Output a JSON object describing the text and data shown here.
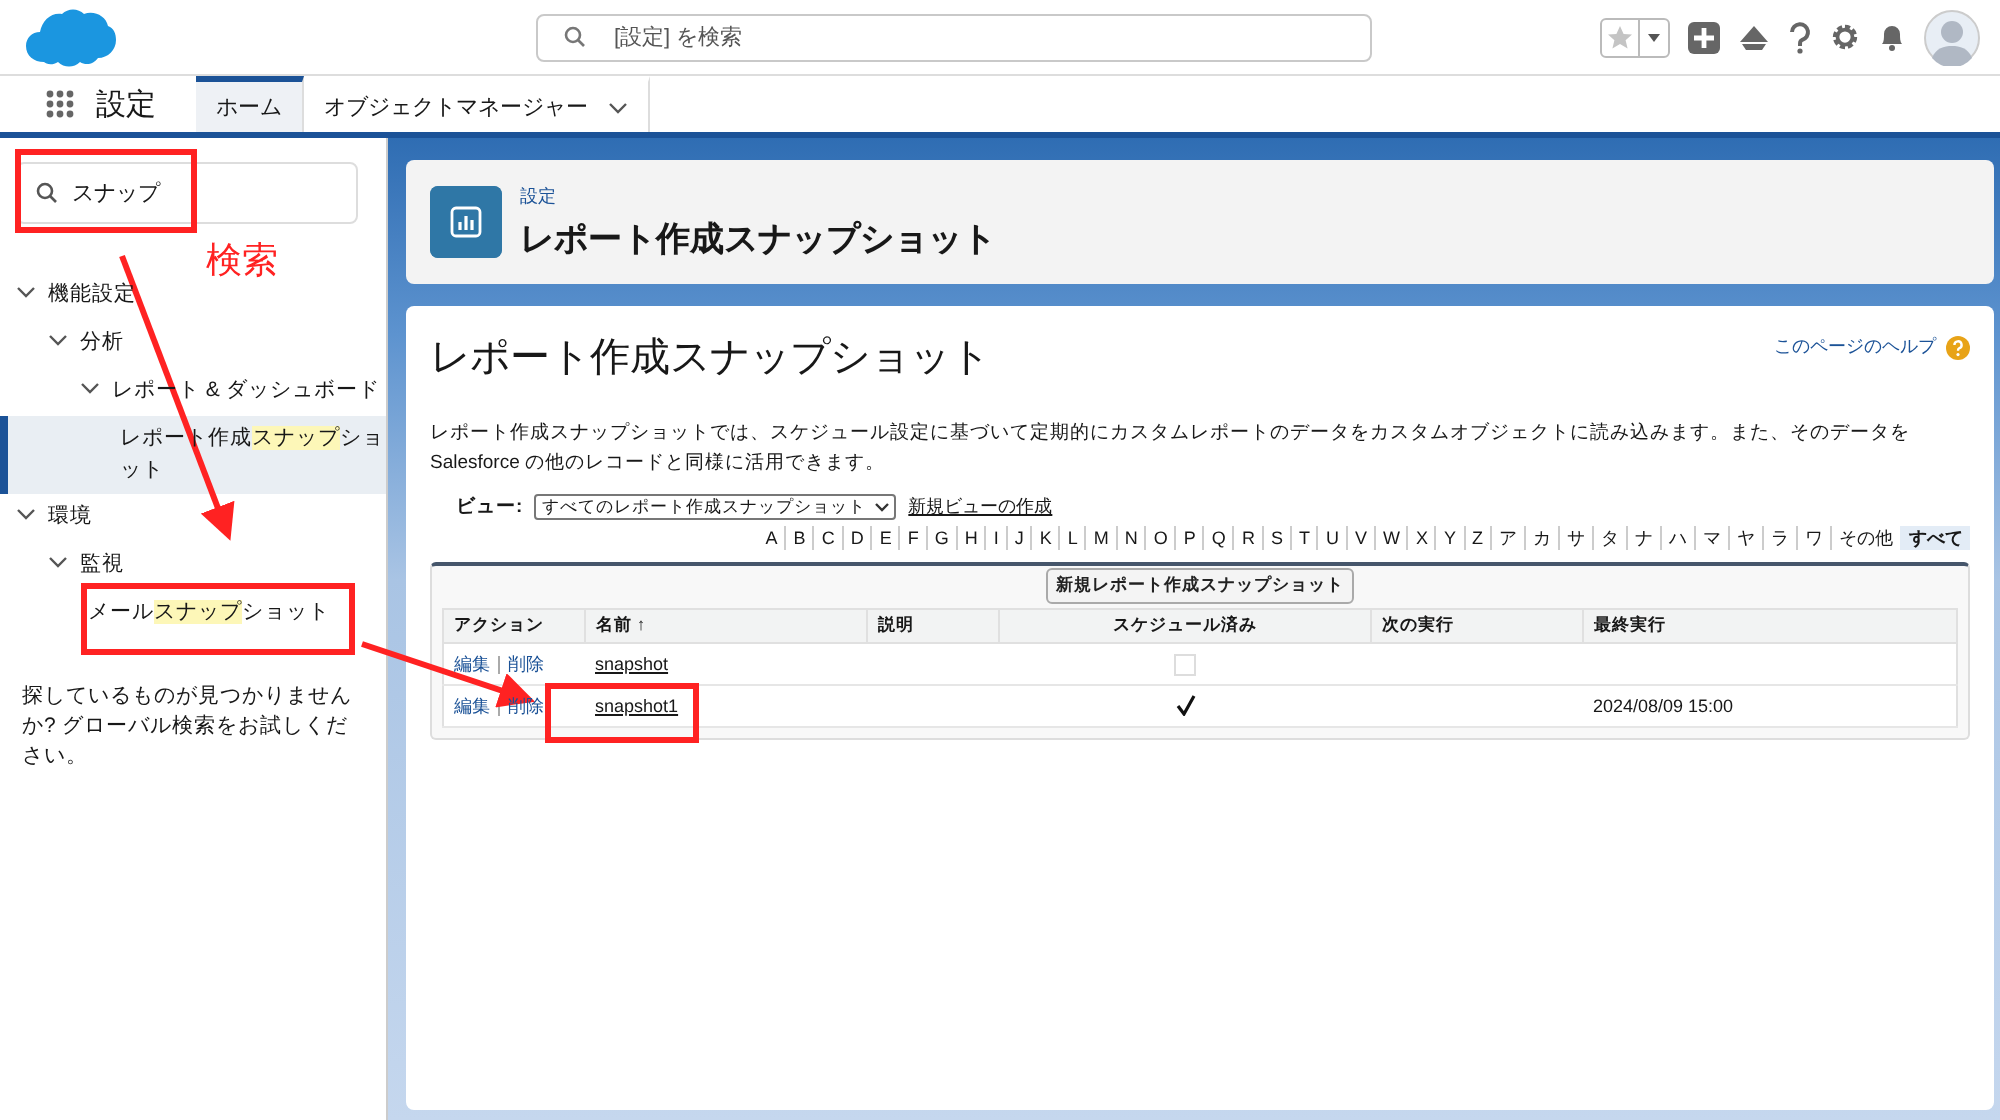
{
  "header": {
    "search": {
      "placeholder": "[設定] を検索"
    },
    "favorite": {
      "on": false
    }
  },
  "nav": {
    "app_name": "設定",
    "tabs": [
      {
        "label": "ホーム",
        "selected": true,
        "dropdown": false
      },
      {
        "label": "オブジェクトマネージャー",
        "selected": false,
        "dropdown": true
      }
    ]
  },
  "sidebar": {
    "search": {
      "value": "スナップ"
    },
    "tree": [
      {
        "label": [
          {
            "text": "機能設定"
          }
        ],
        "expanded": true,
        "selected": false,
        "children": [
          {
            "label": [
              {
                "text": "分析"
              }
            ],
            "expanded": true,
            "selected": false,
            "children": [
              {
                "label": [
                  {
                    "text": "レポート & ダッシュボード"
                  }
                ],
                "expanded": true,
                "selected": false,
                "children": [
                  {
                    "label": [
                      {
                        "text": "レポート作成"
                      },
                      {
                        "text": "スナップ",
                        "match": true
                      },
                      {
                        "text": "ショット"
                      }
                    ],
                    "selected": true
                  }
                ]
              }
            ]
          }
        ]
      },
      {
        "label": [
          {
            "text": "環境"
          }
        ],
        "expanded": true,
        "selected": false,
        "children": [
          {
            "label": [
              {
                "text": "監視"
              }
            ],
            "expanded": true,
            "selected": false,
            "children": [
              {
                "label": [
                  {
                    "text": "メール"
                  },
                  {
                    "text": "スナップ",
                    "match": true
                  },
                  {
                    "text": "ショット"
                  }
                ],
                "selected": false
              }
            ]
          }
        ]
      }
    ],
    "hint": "探しているものが見つかりませんか? グローバル検索をお試しください。"
  },
  "page_header": {
    "breadcrumb": "設定",
    "title": "レポート作成スナップショット"
  },
  "content": {
    "title": "レポート作成スナップショット",
    "help_link": "このページのヘルプ",
    "description": "レポート作成スナップショットでは、スケジュール設定に基づいて定期的にカスタムレポートのデータをカスタムオブジェクトに読み込みます。また、そのデータを Salesforce の他のレコードと同様に活用できます。",
    "view": {
      "label": "ビュー:",
      "value": "すべてのレポート作成スナップショット",
      "new_view_link": "新規ビューの作成"
    },
    "letters": [
      {
        "label": "A",
        "selected": false
      },
      {
        "label": "B",
        "selected": false
      },
      {
        "label": "C",
        "selected": false
      },
      {
        "label": "D",
        "selected": false
      },
      {
        "label": "E",
        "selected": false
      },
      {
        "label": "F",
        "selected": false
      },
      {
        "label": "G",
        "selected": false
      },
      {
        "label": "H",
        "selected": false
      },
      {
        "label": "I",
        "selected": false
      },
      {
        "label": "J",
        "selected": false
      },
      {
        "label": "K",
        "selected": false
      },
      {
        "label": "L",
        "selected": false
      },
      {
        "label": "M",
        "selected": false
      },
      {
        "label": "N",
        "selected": false
      },
      {
        "label": "O",
        "selected": false
      },
      {
        "label": "P",
        "selected": false
      },
      {
        "label": "Q",
        "selected": false
      },
      {
        "label": "R",
        "selected": false
      },
      {
        "label": "S",
        "selected": false
      },
      {
        "label": "T",
        "selected": false
      },
      {
        "label": "U",
        "selected": false
      },
      {
        "label": "V",
        "selected": false
      },
      {
        "label": "W",
        "selected": false
      },
      {
        "label": "X",
        "selected": false
      },
      {
        "label": "Y",
        "selected": false
      },
      {
        "label": "Z",
        "selected": false
      },
      {
        "label": "ア",
        "selected": false
      },
      {
        "label": "カ",
        "selected": false
      },
      {
        "label": "サ",
        "selected": false
      },
      {
        "label": "タ",
        "selected": false
      },
      {
        "label": "ナ",
        "selected": false
      },
      {
        "label": "ハ",
        "selected": false
      },
      {
        "label": "マ",
        "selected": false
      },
      {
        "label": "ヤ",
        "selected": false
      },
      {
        "label": "ラ",
        "selected": false
      },
      {
        "label": "ワ",
        "selected": false
      },
      {
        "label": "その他",
        "selected": false
      },
      {
        "label": "すべて",
        "selected": true
      }
    ],
    "new_button": "新規レポート作成スナップショット",
    "table": {
      "columns": [
        "アクション",
        "名前 ↑",
        "説明",
        "スケジュール済み",
        "次の実行",
        "最終実行"
      ],
      "rows": [
        {
          "actions": [
            "編集",
            "削除"
          ],
          "name": "snapshot",
          "scheduled": false
        },
        {
          "actions": [
            "編集",
            "削除"
          ],
          "name": "snapshot1",
          "scheduled": true,
          "last_run": "2024/08/09 15:00"
        }
      ]
    }
  },
  "annotation": {
    "label": "検索"
  }
}
